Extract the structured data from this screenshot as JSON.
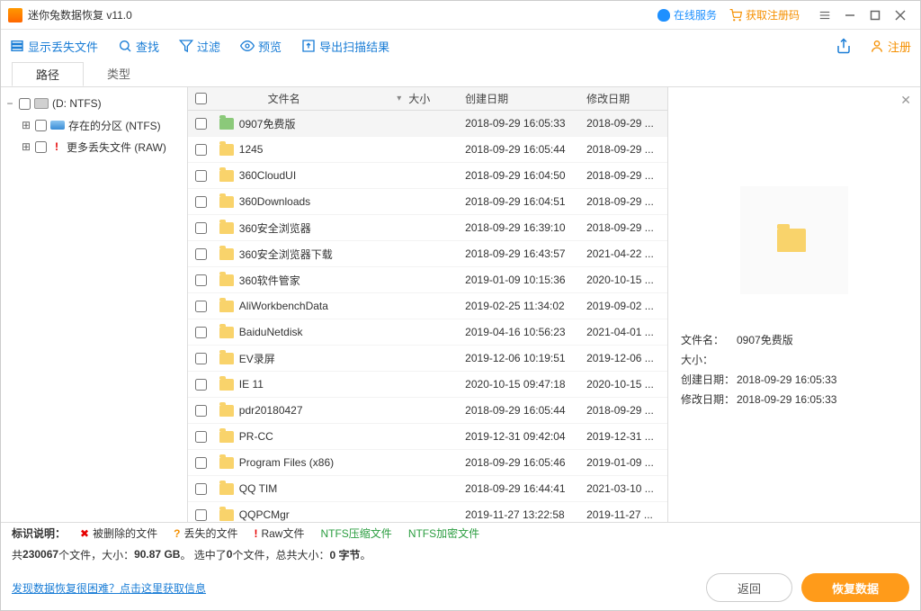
{
  "app": {
    "title": "迷你兔数据恢复 v11.0"
  },
  "topLinks": {
    "service": "在线服务",
    "register": "获取注册码"
  },
  "toolbar": {
    "showLost": "显示丢失文件",
    "find": "查找",
    "filter": "过滤",
    "preview": "预览",
    "export": "导出扫描结果",
    "registerBtn": "注册"
  },
  "tabs": {
    "path": "路径",
    "type": "类型"
  },
  "tree": {
    "root": "(D: NTFS)",
    "part": "存在的分区 (NTFS)",
    "lost": "更多丢失文件 (RAW)"
  },
  "columns": {
    "name": "文件名",
    "size": "大小",
    "created": "创建日期",
    "modified": "修改日期"
  },
  "rows": [
    {
      "name": "0907免费版",
      "green": true,
      "created": "2018-09-29 16:05:33",
      "modified": "2018-09-29 ..."
    },
    {
      "name": "1245",
      "created": "2018-09-29 16:05:44",
      "modified": "2018-09-29 ..."
    },
    {
      "name": "360CloudUI",
      "created": "2018-09-29 16:04:50",
      "modified": "2018-09-29 ..."
    },
    {
      "name": "360Downloads",
      "created": "2018-09-29 16:04:51",
      "modified": "2018-09-29 ..."
    },
    {
      "name": "360安全浏览器",
      "created": "2018-09-29 16:39:10",
      "modified": "2018-09-29 ..."
    },
    {
      "name": "360安全浏览器下载",
      "created": "2018-09-29 16:43:57",
      "modified": "2021-04-22 ..."
    },
    {
      "name": "360软件管家",
      "created": "2019-01-09 10:15:36",
      "modified": "2020-10-15 ..."
    },
    {
      "name": "AliWorkbenchData",
      "created": "2019-02-25 11:34:02",
      "modified": "2019-09-02 ..."
    },
    {
      "name": "BaiduNetdisk",
      "created": "2019-04-16 10:56:23",
      "modified": "2021-04-01 ..."
    },
    {
      "name": "EV录屏",
      "created": "2019-12-06 10:19:51",
      "modified": "2019-12-06 ..."
    },
    {
      "name": "IE 11",
      "created": "2020-10-15 09:47:18",
      "modified": "2020-10-15 ..."
    },
    {
      "name": "pdr20180427",
      "created": "2018-09-29 16:05:44",
      "modified": "2018-09-29 ..."
    },
    {
      "name": "PR-CC",
      "created": "2019-12-31 09:42:04",
      "modified": "2019-12-31 ..."
    },
    {
      "name": "Program Files (x86)",
      "created": "2018-09-29 16:05:46",
      "modified": "2019-01-09 ..."
    },
    {
      "name": "QQ TIM",
      "created": "2018-09-29 16:44:41",
      "modified": "2021-03-10 ..."
    },
    {
      "name": "QQPCMgr",
      "created": "2019-11-27 13:22:58",
      "modified": "2019-11-27 ..."
    }
  ],
  "preview": {
    "nameLabel": "文件名：",
    "nameValue": "0907免费版",
    "sizeLabel": "大小：",
    "createdLabel": "创建日期：",
    "createdValue": "2018-09-29 16:05:33",
    "modifiedLabel": "修改日期：",
    "modifiedValue": "2018-09-29 16:05:33"
  },
  "legend": {
    "title": "标识说明：",
    "deleted": "被删除的文件",
    "lost": "丢失的文件",
    "raw": "Raw文件",
    "ntfsComp": "NTFS压缩文件",
    "ntfsEnc": "NTFS加密文件"
  },
  "status": {
    "p1": "共",
    "filecount": "230067",
    "p2": "个文件，大小：",
    "totalsize": "90.87 GB",
    "p3": "。 选中了",
    "selcount": "0",
    "p4": "个文件，总共大小：",
    "selsize": "0 字节",
    "p5": "。"
  },
  "bottom": {
    "link": "发现数据恢复很困难？点击这里获取信息",
    "back": "返回",
    "recover": "恢复数据"
  }
}
